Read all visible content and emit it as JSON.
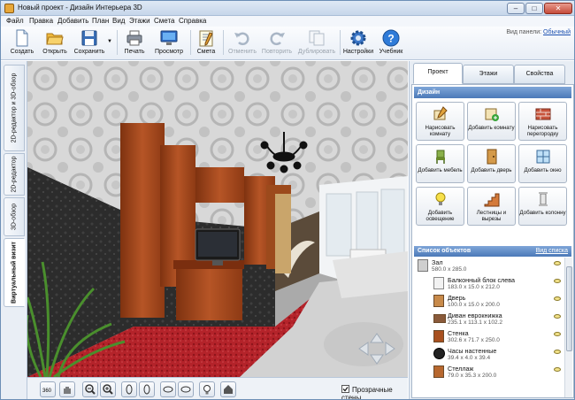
{
  "window": {
    "title": "Новый проект - Дизайн Интерьера 3D",
    "btn_min": "–",
    "btn_max": "□",
    "btn_close": "✕"
  },
  "menu": [
    "Файл",
    "Правка",
    "Добавить",
    "План",
    "Вид",
    "Этажи",
    "Смета",
    "Справка"
  ],
  "toolbar": {
    "buttons": [
      {
        "label": "Создать",
        "icon": "new-document-icon",
        "enabled": true
      },
      {
        "label": "Открыть",
        "icon": "folder-open-icon",
        "enabled": true
      },
      {
        "label": "Сохранить",
        "icon": "floppy-disk-icon",
        "enabled": true
      },
      {
        "label": "Печать",
        "icon": "printer-icon",
        "enabled": true
      },
      {
        "label": "Просмотр",
        "icon": "monitor-icon",
        "enabled": true
      },
      {
        "label": "Смета",
        "icon": "notepad-icon",
        "enabled": true
      },
      {
        "label": "Отменить",
        "icon": "undo-icon",
        "enabled": false
      },
      {
        "label": "Повторить",
        "icon": "redo-icon",
        "enabled": false
      },
      {
        "label": "Дублировать",
        "icon": "duplicate-icon",
        "enabled": false
      },
      {
        "label": "Настройки",
        "icon": "gear-icon",
        "enabled": true
      },
      {
        "label": "Учебник",
        "icon": "help-icon",
        "enabled": true
      }
    ],
    "panel_view_label": "Вид панели:",
    "panel_view_value": "Обычный"
  },
  "left_tabs": [
    {
      "label": "2D-редактор и 3D-обзор",
      "active": false
    },
    {
      "label": "2D-редактор",
      "active": false
    },
    {
      "label": "3D-обзор",
      "active": false
    },
    {
      "label": "Виртуальный визит",
      "active": true
    }
  ],
  "bottom_bar": {
    "tools": [
      "360-view-icon",
      "hand-icon",
      "zoom-out-icon",
      "zoom-in-icon",
      "rotate-left-icon",
      "rotate-right-icon",
      "tilt-down-icon",
      "tilt-up-icon",
      "lightbulb-icon",
      "home-icon"
    ],
    "transparent_walls_label": "Прозрачные стены",
    "transparent_walls_checked": true
  },
  "right_panel": {
    "tabs": [
      {
        "label": "Проект",
        "active": true
      },
      {
        "label": "Этажи",
        "active": false
      },
      {
        "label": "Свойства",
        "active": false
      }
    ],
    "design_header": "Дизайн",
    "design_buttons": [
      {
        "label": "Нарисовать комнату",
        "icon": "draw-room-icon"
      },
      {
        "label": "Добавить комнату",
        "icon": "add-room-icon"
      },
      {
        "label": "Нарисовать перегородку",
        "icon": "brick-wall-icon"
      },
      {
        "label": "Добавить мебель",
        "icon": "chair-icon"
      },
      {
        "label": "Добавить дверь",
        "icon": "door-icon"
      },
      {
        "label": "Добавить окно",
        "icon": "window-icon"
      },
      {
        "label": "Добавить освещение",
        "icon": "light-bulb-icon"
      },
      {
        "label": "Лестницы и вырезы",
        "icon": "stairs-icon"
      },
      {
        "label": "Добавить колонну",
        "icon": "column-icon"
      }
    ],
    "objects_header": "Список объектов",
    "objects_view_label": "Вид списка",
    "objects": [
      {
        "name": "Зал",
        "dims": "580.0 x 285.0",
        "icon": "room-icon",
        "indent": false
      },
      {
        "name": "Балконный блок слева",
        "dims": "183.0 x 15.0 x 212.0",
        "icon": "balcony-door-icon",
        "indent": true
      },
      {
        "name": "Дверь",
        "dims": "100.0 x 15.0 x 200.0",
        "icon": "door-icon",
        "indent": true
      },
      {
        "name": "Диван еврокнижка",
        "dims": "235.1 x 113.1 x 102.2",
        "icon": "sofa-icon",
        "indent": true
      },
      {
        "name": "Стенка",
        "dims": "302.6 x 71.7 x 250.0",
        "icon": "wall-unit-icon",
        "indent": true
      },
      {
        "name": "Часы настенные",
        "dims": "39.4 x 4.0 x 39.4",
        "icon": "clock-icon",
        "indent": true
      },
      {
        "name": "Стеллаж",
        "dims": "79.0 x 35.3 x 200.0",
        "icon": "shelf-icon",
        "indent": true
      }
    ]
  },
  "colors": {
    "accent": "#4b79b8",
    "carpet": "#b8242b",
    "furniture": "#a2471c",
    "wall_dark": "#2a2a2a",
    "ceiling": "#d9d9d9"
  }
}
